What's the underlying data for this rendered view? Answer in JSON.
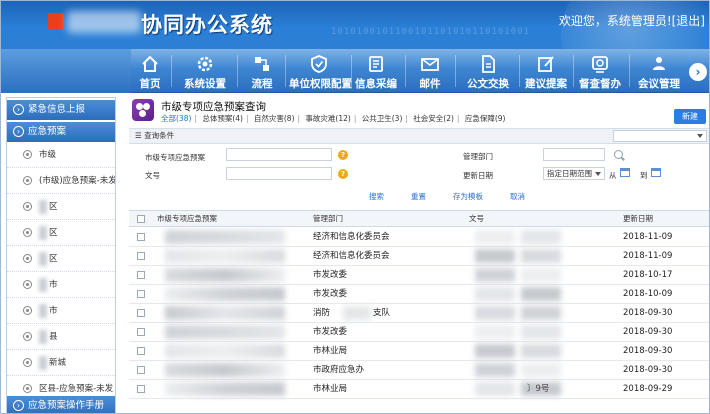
{
  "header": {
    "system_title": "协同办公系统",
    "welcome": "欢迎您，系统管理员!",
    "logout": "[退出]",
    "binary_strip": "1010100101100101101010110101001"
  },
  "nav": [
    {
      "label": "首页",
      "icon": "home-icon"
    },
    {
      "label": "系统设置",
      "icon": "settings-icon"
    },
    {
      "label": "流程",
      "icon": "flow-icon"
    },
    {
      "label": "单位权限配置",
      "icon": "shield-icon"
    },
    {
      "label": "信息采编",
      "icon": "info-icon"
    },
    {
      "label": "邮件",
      "icon": "mail-icon"
    },
    {
      "label": "公文交换",
      "icon": "document-icon"
    },
    {
      "label": "建议提案",
      "icon": "edit-icon"
    },
    {
      "label": "督查督办",
      "icon": "inspect-icon"
    },
    {
      "label": "会议管理",
      "icon": "meeting-icon"
    }
  ],
  "sidebar": {
    "sections": [
      {
        "label": "紧急信息上报"
      },
      {
        "label": "应急预案"
      }
    ],
    "items": [
      {
        "label": "市级"
      },
      {
        "label": "(市级)应急预案-未发"
      },
      {
        "label": "区"
      },
      {
        "label": "区"
      },
      {
        "label": "区"
      },
      {
        "label": "市"
      },
      {
        "label": "市"
      },
      {
        "label": "县"
      },
      {
        "label": "新城"
      },
      {
        "label": "区县-应急预案-未发"
      }
    ],
    "footer": "应急预案操作手册"
  },
  "page": {
    "title": "市级专项应急预案查询",
    "tabs": [
      {
        "label": "全部(38)",
        "active": true
      },
      {
        "label": "总体预案(4)"
      },
      {
        "label": "自然灾害(8)"
      },
      {
        "label": "事故灾难(12)"
      },
      {
        "label": "公共卫生(3)"
      },
      {
        "label": "社会安全(2)"
      },
      {
        "label": "应急保障(9)"
      }
    ],
    "new_button": "新建"
  },
  "search": {
    "bar_label": "查询条件",
    "plan_label": "市级专项应急预案",
    "docno_label": "文号",
    "dept_label": "管理部门",
    "update_label": "更新日期",
    "date_range": "指定日期范围",
    "from": "从",
    "to": "到",
    "actions": {
      "search": "搜索",
      "reset": "重置",
      "save_template": "存为模板",
      "cancel": "取消"
    }
  },
  "table": {
    "columns": [
      "市级专项应急预案",
      "管理部门",
      "文号",
      "更新日期"
    ],
    "rows": [
      {
        "dept": "经济和信息化委员会",
        "date": "2018-11-09"
      },
      {
        "dept": "经济和信息化委员会",
        "date": "2018-11-09"
      },
      {
        "dept": "市发改委",
        "date": "2018-10-17"
      },
      {
        "dept": "市发改委",
        "date": "2018-10-09"
      },
      {
        "dept": "消防",
        "dept_tail": "支队",
        "date": "2018-09-30"
      },
      {
        "dept": "市发改委",
        "date": "2018-09-30"
      },
      {
        "dept": "市林业局",
        "date": "2018-09-30"
      },
      {
        "dept": "市政府应急办",
        "date": "2018-09-30"
      },
      {
        "dept": "市林业局",
        "date": "2018-09-29"
      }
    ],
    "fragment": "〕9号"
  },
  "colors": {
    "accent": "#2b7de1",
    "header": "#1d63b8",
    "nav": "#3f86d2",
    "icon_badge": "#6a2a9a"
  }
}
